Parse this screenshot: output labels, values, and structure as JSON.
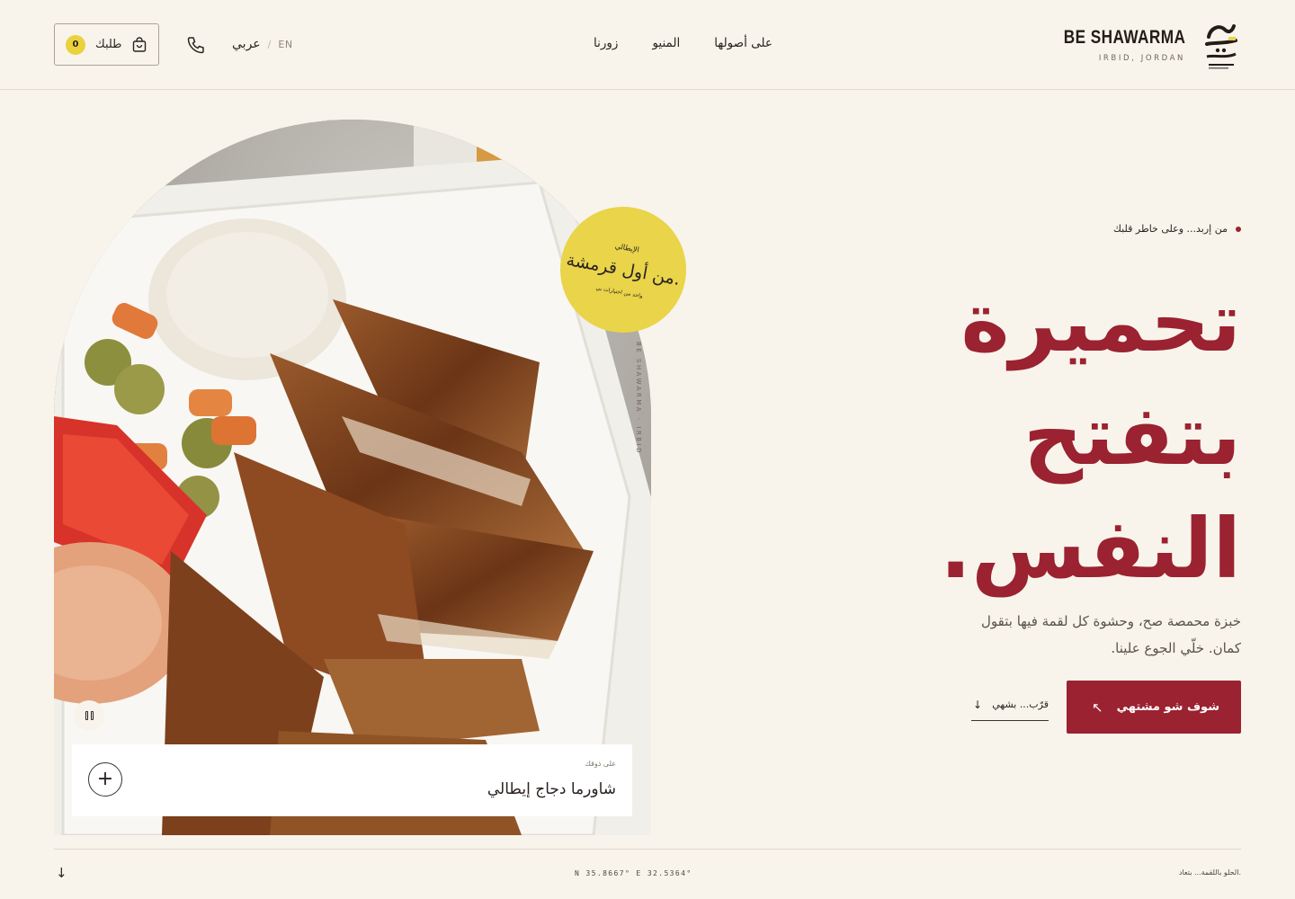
{
  "header": {
    "brand_name": "BE SHAWARMA",
    "brand_location": "IRBID, JORDAN",
    "logo_text": "بي شاورما",
    "nav": [
      "زورنا",
      "المنيو",
      "على أصولها"
    ],
    "lang_active": "عربي",
    "lang_separator": "/",
    "lang_alt": "EN",
    "cart_label": "طلبك",
    "cart_count": "0"
  },
  "hero": {
    "tagline": "من إربد... وعلى خاطر قلبك",
    "headline": [
      "تحميرة",
      "بتفتح",
      "النفس."
    ],
    "description": "خبزة محمصة صح، وحشوة كل لقمة فيها بتقول كمان. خلّي الجوع علينا.",
    "cta_label": "شوف شو مشتهي",
    "secondary_label": "قرّب... بشهي"
  },
  "image": {
    "side_text": "BE SHAWARMA · IRBID",
    "sticker_top": "الإيطالي",
    "sticker_main": "من أول قرمشة.",
    "sticker_bottom": "واحد من اختيارات بي",
    "caption_small": "على ذوقك",
    "caption_title": "شاورما دجاج إيطالي"
  },
  "footer": {
    "coords": "N  35.8667° E 32.5364°",
    "note": "الحلو باللقمة... بتعاد."
  },
  "colors": {
    "background": "#f8f4eb",
    "accent_red": "#9b2230",
    "accent_yellow": "#e9d44a",
    "text_dark": "#2a2320"
  }
}
